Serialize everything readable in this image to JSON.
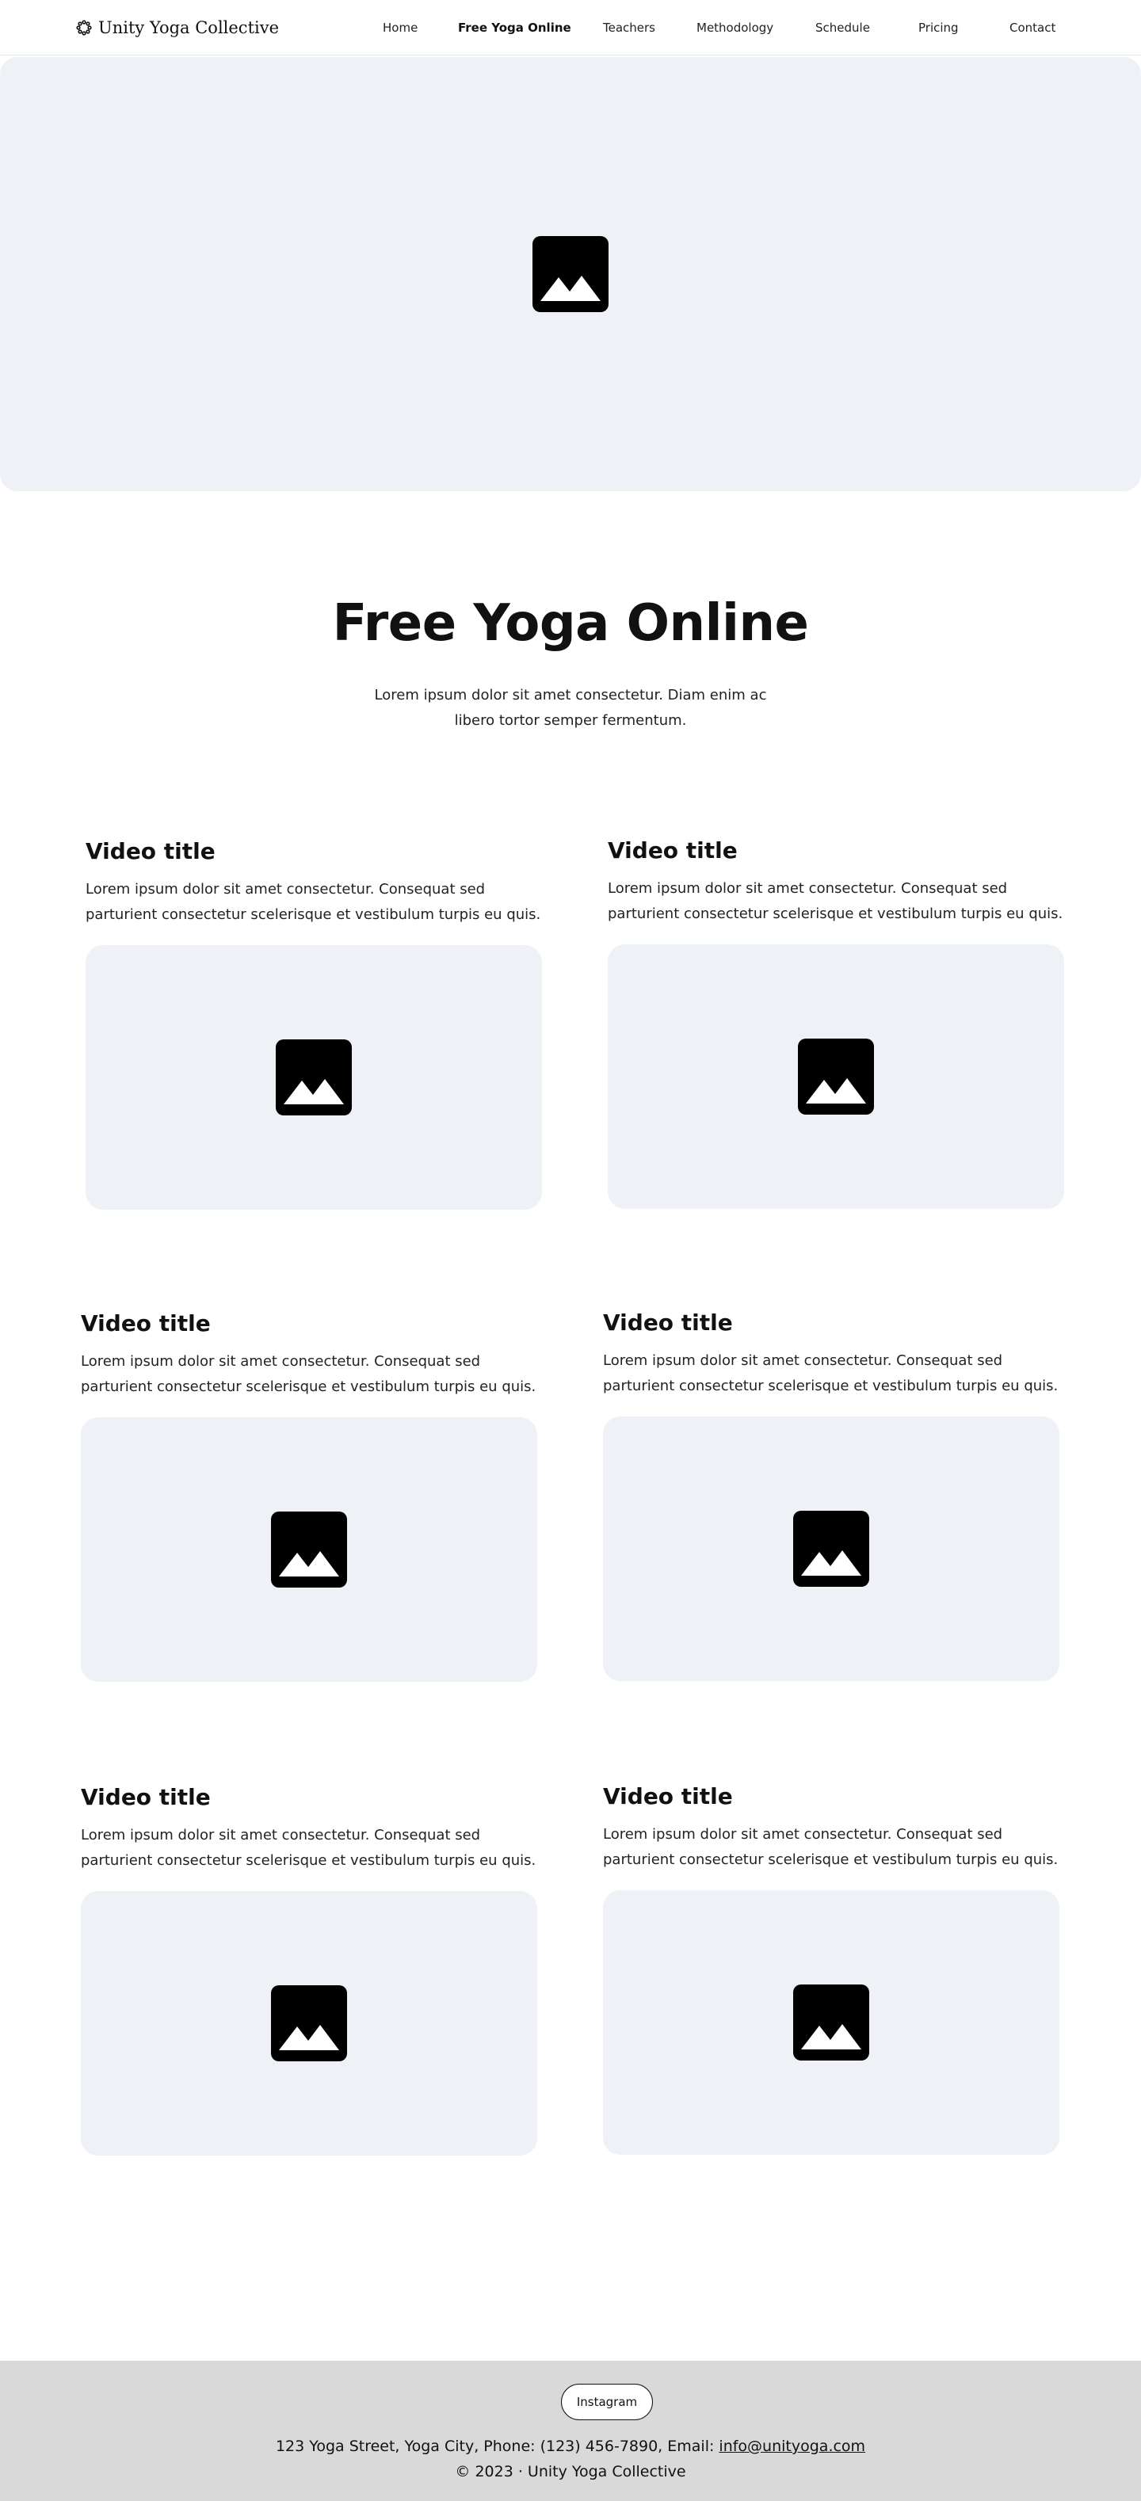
{
  "header": {
    "brand": "Unity Yoga Collective",
    "nav": [
      "Home",
      "Free Yoga Online",
      "Teachers",
      "Methodology",
      "Schedule",
      "Pricing",
      "Contact"
    ],
    "active_nav": "Free Yoga Online"
  },
  "hero": {
    "image_icon": "image-placeholder-icon"
  },
  "intro": {
    "title": "Free Yoga Online",
    "text": "Lorem ipsum dolor sit amet consectetur. Diam enim ac libero tortor semper fermentum."
  },
  "videos": [
    {
      "title": "Video title",
      "description": "Lorem ipsum dolor sit amet consectetur. Consequat sed parturient consectetur scelerisque et vestibulum turpis eu quis."
    },
    {
      "title": "Video title",
      "description": "Lorem ipsum dolor sit amet consectetur. Consequat sed parturient consectetur scelerisque et vestibulum turpis eu quis."
    },
    {
      "title": "Video title",
      "description": "Lorem ipsum dolor sit amet consectetur. Consequat sed parturient consectetur scelerisque et vestibulum turpis eu quis."
    },
    {
      "title": "Video title",
      "description": "Lorem ipsum dolor sit amet consectetur. Consequat sed parturient consectetur scelerisque et vestibulum turpis eu quis."
    },
    {
      "title": "Video title",
      "description": "Lorem ipsum dolor sit amet consectetur. Consequat sed parturient consectetur scelerisque et vestibulum turpis eu quis."
    },
    {
      "title": "Video title",
      "description": "Lorem ipsum dolor sit amet consectetur. Consequat sed parturient consectetur scelerisque et vestibulum turpis eu quis."
    }
  ],
  "footer": {
    "social_button": "Instagram",
    "contact_prefix": "123 Yoga Street, Yoga City, Phone: (123) 456-7890, Email: ",
    "email": "info@unityoga.com",
    "copyright": "© 2023 · Unity Yoga Collective"
  },
  "colors": {
    "placeholder_bg": "#eef1f5",
    "footer_bg": "#d9d9d9",
    "text": "#111111"
  }
}
